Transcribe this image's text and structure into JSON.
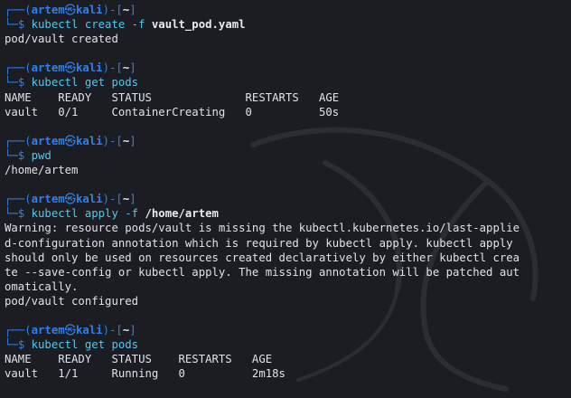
{
  "prompt": {
    "user": "artem",
    "at_symbol": "㉿",
    "host": "kali",
    "cwd": "~",
    "dollar": "$"
  },
  "blocks": [
    {
      "cmd": "kubectl create -f ",
      "arg": "vault_pod.yaml",
      "output": [
        "pod/vault created"
      ]
    },
    {
      "cmd": "kubectl get pods",
      "arg": "",
      "output": [
        "NAME    READY   STATUS              RESTARTS   AGE",
        "vault   0/1     ContainerCreating   0          50s"
      ]
    },
    {
      "cmd": "pwd",
      "arg": "",
      "output": [
        "/home/artem"
      ]
    },
    {
      "cmd": "kubectl apply -f ",
      "arg": "/home/artem",
      "output": [
        "Warning: resource pods/vault is missing the kubectl.kubernetes.io/last-applie",
        "d-configuration annotation which is required by kubectl apply. kubectl apply",
        "should only be used on resources created declaratively by either kubectl crea",
        "te --save-config or kubectl apply. The missing annotation will be patched aut",
        "omatically.",
        "pod/vault configured"
      ]
    },
    {
      "cmd": "kubectl get pods",
      "arg": "",
      "output": [
        "NAME    READY   STATUS    RESTARTS   AGE",
        "vault   1/1     Running   0          2m18s"
      ]
    }
  ],
  "colors": {
    "background": "#1b1d22",
    "prompt_frame": "#2f80ed",
    "command": "#52c8f0",
    "text": "#dfe3e8"
  },
  "icons": {
    "background": "kali-dragon-watermark-icon"
  }
}
